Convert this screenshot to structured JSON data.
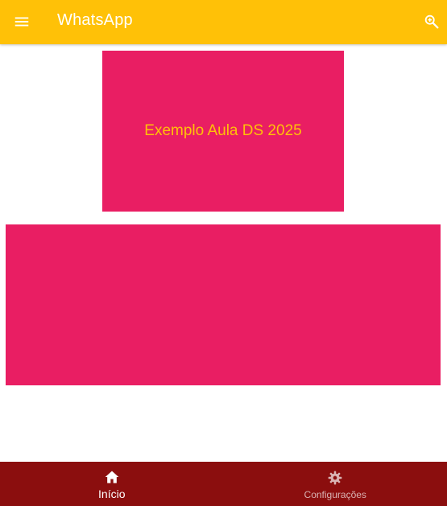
{
  "appbar": {
    "title": "WhatsApp",
    "menu_icon": "menu-icon",
    "search_icon": "zoom-in-icon",
    "background": "#FFC107"
  },
  "content": {
    "top_card": {
      "text": "Exemplo Aula DS 2025",
      "background": "#E91E63",
      "text_color": "#FFC107"
    },
    "bottom_card": {
      "background": "#E91E63"
    }
  },
  "bottom_nav": {
    "background": "#8B0E0E",
    "items": [
      {
        "label": "Início",
        "icon": "home-icon",
        "active": true
      },
      {
        "label": "Configurações",
        "icon": "settings-icon",
        "active": false
      }
    ]
  }
}
